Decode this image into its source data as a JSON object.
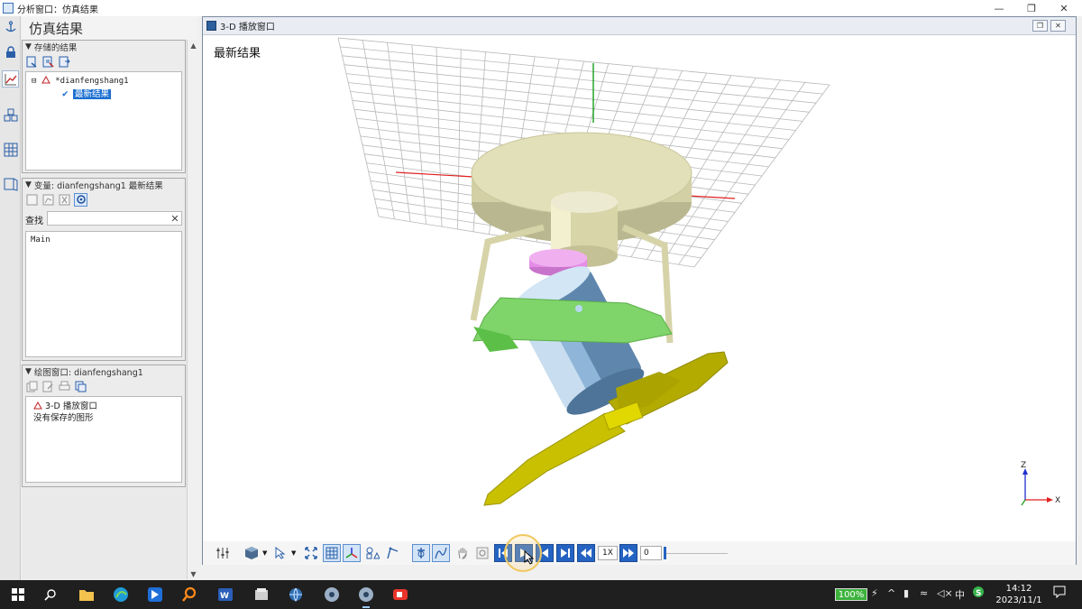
{
  "window": {
    "title": "分析窗口：仿真结果",
    "min_glyph": "—",
    "max_glyph": "❐",
    "close_glyph": "✕"
  },
  "panel": {
    "header": "仿真结果",
    "stored": {
      "title": "存储的结果",
      "tree_root": "*dianfengshang1",
      "tree_child": "最新结果"
    },
    "variables": {
      "title": "变量:  dianfengshang1 最新结果",
      "search_label": "查找",
      "search_value": "",
      "clear_glyph": "✕",
      "list_item": "Main"
    },
    "plot": {
      "title": "绘图窗口:  dianfengshang1",
      "item": "3-D  播放窗口",
      "empty_text": "没有保存的图形"
    }
  },
  "window3d": {
    "title": "3-D  播放窗口",
    "label": "最新结果",
    "axis_z": "Z",
    "axis_x": "X",
    "speed": "1X",
    "frame": "0"
  },
  "taskbar": {
    "battery": "100%",
    "ime": "中",
    "time": "14:12",
    "date": "2023/11/1"
  },
  "colors": {
    "selection_blue": "#1c6fd1",
    "fan_base": "#e2e0b8",
    "motor_blue": "#9ec5e6",
    "bracket_green": "#7fd46a",
    "blade_yellow": "#c8c000",
    "collar_pink": "#e58ce6",
    "axis_red": "#e02020",
    "axis_green": "#1aa01a",
    "axis_blue": "#2030d0"
  },
  "icons": {
    "leftstrip": [
      "anchor-icon",
      "lock-icon",
      "chart-icon",
      "cubes-icon",
      "grid-icon",
      "book-icon"
    ],
    "toolbar": [
      "settings-icon",
      "view-cube-icon",
      "pointer-icon",
      "fit-icon",
      "grid-toggle-icon",
      "axes-icon",
      "shape-icon",
      "vector-icon",
      "track-icon",
      "curve-icon",
      "hand-icon",
      "frame-icon",
      "first-frame-icon",
      "play-icon",
      "step-back-icon",
      "last-frame-icon",
      "slower-icon",
      "faster-icon"
    ]
  }
}
